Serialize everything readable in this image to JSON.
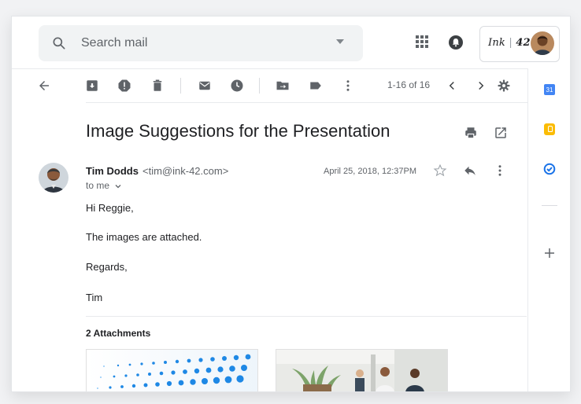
{
  "search": {
    "placeholder": "Search mail"
  },
  "account": {
    "brand_script": "Ink",
    "brand_number": "42"
  },
  "toolbar": {
    "pager": "1-16 of 16"
  },
  "email": {
    "subject": "Image Suggestions for the Presentation",
    "sender_name": "Tim Dodds",
    "sender_email": "<tim@ink-42.com>",
    "to": "to me",
    "date": "April 25, 2018, 12:37PM",
    "body": [
      "Hi Reggie,",
      "The images are attached.",
      "Regards,",
      "Tim"
    ],
    "attachments_title": "2 Attachments"
  },
  "side_panel": {
    "calendar_day": "31",
    "colors": {
      "calendar": "#4285f4",
      "keep": "#fbbc04",
      "tasks": "#1a73e8"
    }
  },
  "icons": [
    "search-icon",
    "dropdown-caret-icon",
    "apps-grid-icon",
    "notifications-icon",
    "back-arrow-icon",
    "archive-icon",
    "report-spam-icon",
    "delete-icon",
    "mark-unread-icon",
    "snooze-icon",
    "move-to-icon",
    "label-icon",
    "more-vert-icon",
    "chevron-left-icon",
    "chevron-right-icon",
    "settings-gear-icon",
    "print-icon",
    "open-in-new-window-icon",
    "star-icon",
    "reply-icon",
    "plus-icon"
  ]
}
